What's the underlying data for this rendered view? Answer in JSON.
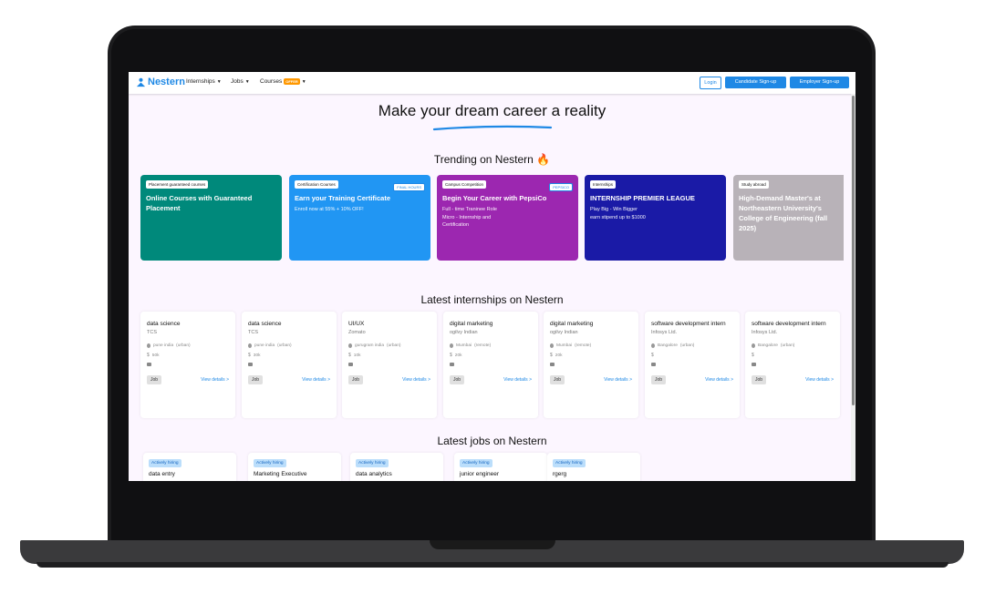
{
  "nav": {
    "logo": "Nestern",
    "items": [
      {
        "label": "Internships"
      },
      {
        "label": "Jobs"
      },
      {
        "label": "Courses",
        "badge": "OFFER"
      }
    ],
    "login": "Login",
    "candidate_signup": "Candidate Sign-up",
    "employer_signup": "Employer Sign-up"
  },
  "hero": {
    "title": "Make your dream career a reality"
  },
  "trending": {
    "title": "Trending on Nestern 🔥",
    "cards": [
      {
        "tag": "Placement guaranteed courses",
        "title": "Online Courses with Guaranteed Placement",
        "sub": "",
        "badge": "",
        "color": "#00897b"
      },
      {
        "tag": "Certification Courses",
        "title": "Earn your Training Certificate",
        "sub": "Enroll now at 55% + 10% OFF!",
        "badge": "FINAL HOURS",
        "color": "#2196f3"
      },
      {
        "tag": "Campus Competition",
        "title": "Begin Your Career with PepsiCo",
        "sub": "Full - time Traninee Role\nMicro - Internship and\nCertification",
        "badge": "PEPSICO",
        "color": "#9c27b0"
      },
      {
        "tag": "Internships",
        "title": "INTERNSHIP PREMIER LEAGUE",
        "sub": "Play Big - Win Bigger\nearn stipend up to $1000",
        "badge": "",
        "color": "#1a1aa6"
      },
      {
        "tag": "Study abroad",
        "title": "High-Demand Master's at Northeastern University's College of Engineering (fall 2025)",
        "sub": "",
        "badge": "",
        "color": "#b8b2b8"
      }
    ]
  },
  "internships": {
    "title": "Latest internships on Nestern",
    "job_label": "Job",
    "view_label": "View details >",
    "cards": [
      {
        "role": "data science",
        "company": "TCS",
        "location": "pune india",
        "mode": "(urban)",
        "stipend": "50k"
      },
      {
        "role": "data science",
        "company": "TCS",
        "location": "pune india",
        "mode": "(urban)",
        "stipend": "30k"
      },
      {
        "role": "UI/UX",
        "company": "Zomato",
        "location": "gurugram india",
        "mode": "(urban)",
        "stipend": "10k"
      },
      {
        "role": "digital marketing",
        "company": "ogilvy Indian",
        "location": "Mumbai",
        "mode": "(remote)",
        "stipend": "20k"
      },
      {
        "role": "digital marketing",
        "company": "ogilvy Indian",
        "location": "Mumbai",
        "mode": "(remote)",
        "stipend": "20k"
      },
      {
        "role": "software development intern",
        "company": "Infosys Ltd.",
        "location": "Bangalore",
        "mode": "(urban)",
        "stipend": ""
      },
      {
        "role": "software development intern",
        "company": "Infosys Ltd.",
        "location": "Bangalore",
        "mode": "(urban)",
        "stipend": ""
      }
    ]
  },
  "jobs": {
    "title": "Latest jobs on Nestern",
    "badge": "Actively hiring",
    "cards": [
      {
        "title": "data entry"
      },
      {
        "title": "Marketing Executive"
      },
      {
        "title": "data analytics"
      },
      {
        "title": "junior engineer"
      },
      {
        "title": "rgerg"
      }
    ]
  }
}
